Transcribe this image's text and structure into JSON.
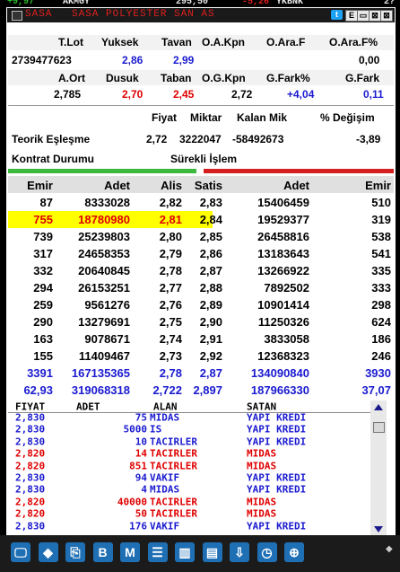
{
  "ticker": [
    {
      "text": "+9,97",
      "color": "#2ebd2e"
    },
    {
      "text": "AKMGY",
      "color": "#e8e8e8"
    },
    {
      "text": "295,50",
      "color": "#e8e8e8"
    },
    {
      "text": "-5,26",
      "color": "#e02020"
    },
    {
      "text": "YKBNK",
      "color": "#e8e8e8"
    },
    {
      "text": "2?",
      "color": "#e8e8e8"
    }
  ],
  "window": {
    "symbol": "SASA",
    "name": "SASA POLYESTER SAN AS",
    "e_btn": "E",
    "min_btn": "▭",
    "max_btn": "⊠",
    "close_btn": "⊠"
  },
  "stats1": {
    "headers": [
      "T.Lot",
      "Yuksek",
      "Tavan",
      "O.A.Kpn",
      "O.Ara.F",
      "O.Ara.F%"
    ],
    "values": [
      "2739477623",
      "2,86",
      "2,99",
      "",
      "",
      "0,00"
    ]
  },
  "stats2": {
    "headers": [
      "A.Ort",
      "Dusuk",
      "Taban",
      "O.G.Kpn",
      "G.Fark%",
      "G.Fark"
    ],
    "values": [
      "2,785",
      "2,70",
      "2,45",
      "2,72",
      "+4,04",
      "0,11"
    ]
  },
  "theo": {
    "headers": [
      "Fiyat",
      "Miktar",
      "Kalan Mik",
      "% Değişim"
    ],
    "label": "Teorik Eşleşme",
    "fiyat": "2,72",
    "miktar": "3222047",
    "kalan": "-58492673",
    "degisim": "-3,89",
    "kontrat_label": "Kontrat Durumu",
    "kontrat_value": "Sürekli İşlem"
  },
  "depth": {
    "headers": [
      "Emir",
      "Adet",
      "Alis",
      "Satis",
      "Adet",
      "Emir"
    ],
    "rows": [
      [
        "87",
        "8333028",
        "2,82",
        "2,83",
        "15406459",
        "510"
      ],
      [
        "755",
        "18780980",
        "2,81",
        "2,84",
        "19529377",
        "319"
      ],
      [
        "739",
        "25239803",
        "2,80",
        "2,85",
        "26458816",
        "538"
      ],
      [
        "317",
        "24658353",
        "2,79",
        "2,86",
        "13183643",
        "541"
      ],
      [
        "332",
        "20640845",
        "2,78",
        "2,87",
        "13266922",
        "335"
      ],
      [
        "294",
        "26153251",
        "2,77",
        "2,88",
        "7892502",
        "333"
      ],
      [
        "259",
        "9561276",
        "2,76",
        "2,89",
        "10901414",
        "298"
      ],
      [
        "290",
        "13279691",
        "2,75",
        "2,90",
        "11250326",
        "624"
      ],
      [
        "163",
        "9078671",
        "2,74",
        "2,91",
        "3833058",
        "186"
      ],
      [
        "155",
        "11409467",
        "2,73",
        "2,92",
        "12368323",
        "246"
      ]
    ],
    "total1": [
      "3391",
      "167135365",
      "2,78",
      "2,87",
      "134090840",
      "3930"
    ],
    "total2": [
      "62,93",
      "319068318",
      "2,722",
      "2,897",
      "187966330",
      "37,07"
    ]
  },
  "tape": {
    "headers": [
      "FIYAT",
      "ADET",
      "ALAN",
      "SATAN"
    ],
    "rows": [
      {
        "fiyat": "2,830",
        "adet": "75",
        "alan": "MIDAS",
        "satan": "YAPI KREDI",
        "color": "#1a1ad0"
      },
      {
        "fiyat": "2,830",
        "adet": "5000",
        "alan": "IS",
        "satan": "YAPI KREDI",
        "color": "#1a1ad0"
      },
      {
        "fiyat": "2,830",
        "adet": "10",
        "alan": "TACIRLER",
        "satan": "YAPI KREDI",
        "color": "#1a1ad0"
      },
      {
        "fiyat": "2,820",
        "adet": "14",
        "alan": "TACIRLER",
        "satan": "MIDAS",
        "color": "#e00000"
      },
      {
        "fiyat": "2,820",
        "adet": "851",
        "alan": "TACIRLER",
        "satan": "MIDAS",
        "color": "#e00000"
      },
      {
        "fiyat": "2,830",
        "adet": "94",
        "alan": "VAKIF",
        "satan": "YAPI KREDI",
        "color": "#1a1ad0"
      },
      {
        "fiyat": "2,830",
        "adet": "4",
        "alan": "MIDAS",
        "satan": "YAPI KREDI",
        "color": "#1a1ad0"
      },
      {
        "fiyat": "2,820",
        "adet": "40000",
        "alan": "TACIRLER",
        "satan": "MIDAS",
        "color": "#e00000"
      },
      {
        "fiyat": "2,820",
        "adet": "50",
        "alan": "TACIRLER",
        "satan": "MIDAS",
        "color": "#e00000"
      },
      {
        "fiyat": "2,830",
        "adet": "176",
        "alan": "VAKIF",
        "satan": "YAPI KREDI",
        "color": "#1a1ad0"
      }
    ]
  },
  "toolbar": {
    "items": [
      {
        "icon": "monitor-icon",
        "glyph": "🖵"
      },
      {
        "icon": "cube-icon",
        "glyph": "◆"
      },
      {
        "icon": "document-export-icon",
        "glyph": "⎘"
      },
      {
        "icon": "bold-b-icon",
        "glyph": "B"
      },
      {
        "icon": "m-logo-icon",
        "glyph": "M"
      },
      {
        "icon": "list-icon",
        "glyph": "☰"
      },
      {
        "icon": "bar-chart-icon",
        "glyph": "▥"
      },
      {
        "icon": "news-icon",
        "glyph": "▤"
      },
      {
        "icon": "download-icon",
        "glyph": "⇩"
      },
      {
        "icon": "clock-icon",
        "glyph": "◷"
      },
      {
        "icon": "globe-icon",
        "glyph": "⊕"
      }
    ]
  },
  "colors": {
    "blue": "#1a1ad0",
    "red": "#e00000",
    "highlight": "#ffff00",
    "toolbar_button": "#1f6fb5"
  }
}
